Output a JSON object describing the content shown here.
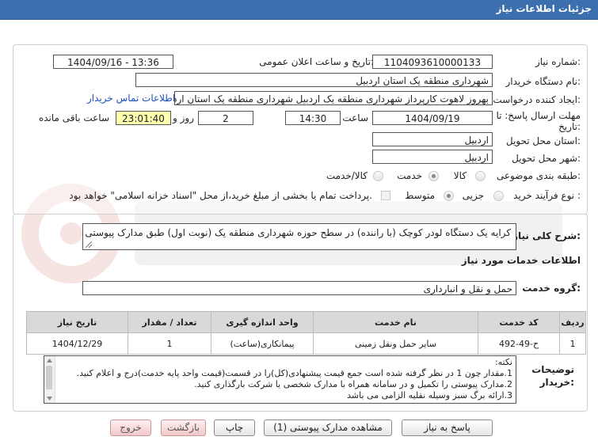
{
  "header": {
    "title": "جزئیات اطلاعات نیاز"
  },
  "fields": {
    "need_number_label": "شماره نیاز:",
    "need_number": "1104093610000133",
    "announce_label": "تاریخ و ساعت اعلان عمومی:",
    "announce_value": "1404/09/16 - 13:36",
    "buyer_label": "نام دستگاه خریدار:",
    "buyer_value": "شهرداری منطقه یک استان اردبیل",
    "creator_label": "ایجاد کننده درخواست:",
    "creator_value": "بهروز لاهوت کارپرداز شهرداری منطقه یک اردبیل شهرداری منطقه یک استان اردبیل",
    "contact_link": "اطلاعات تماس خریدار",
    "deadline_label_1": "مهلت ارسال پاسخ: تا",
    "deadline_label_2": "تاریخ:",
    "deadline_date": "1404/09/19",
    "time_label": "ساعت",
    "deadline_time": "14:30",
    "days_value": "2",
    "days_label": "روز و",
    "remaining_time": "23:01:40",
    "remaining_label": "ساعت باقی مانده",
    "province_label": "استان محل تحویل:",
    "province_value": "اردبیل",
    "city_label": "شهر محل تحویل:",
    "city_value": "اردبیل",
    "category_label": "طبقه بندی موضوعی:",
    "category_options": [
      "کالا",
      "خدمت",
      "کالا/خدمت"
    ],
    "process_label": "نوع فرآیند خرید :",
    "process_options": [
      "جزیی",
      "متوسط"
    ],
    "payment_note": "پرداخت تمام یا بخشی از مبلغ خرید،از محل \"اسناد خزانه اسلامی\" خواهد بود."
  },
  "summary": {
    "label": "شرح کلی نیاز:",
    "value": "کرایه یک دستگاه لودر کوچک (با راننده) در سطح حوزه شهرداری منطقه یک (نوبت اول) طبق مدارک پیوستی"
  },
  "services": {
    "section_title": "اطلاعات خدمات مورد نیاز",
    "group_label": "گروه خدمت:",
    "group_value": "حمل و نقل و انبارداری",
    "columns": [
      "ردیف",
      "کد خدمت",
      "نام خدمت",
      "واحد اندازه گیری",
      "تعداد / مقدار",
      "تاریخ نیاز"
    ],
    "rows": [
      {
        "idx": "1",
        "code": "ح-49-492",
        "name": "سایر حمل ونقل زمینی",
        "unit": "پیمانکاری(ساعت)",
        "qty": "1",
        "date": "1404/12/29"
      }
    ]
  },
  "notes": {
    "label_1": "توضیحات",
    "label_2": "خریدار:",
    "lines": [
      "نکته:",
      "1.مقدار چون 1 در نظر گرفته شده است جمع قیمت پیشنهادی(کل)را در قسمت(قیمت واحد پایه خدمت)درج و اعلام کنید.",
      "2.مدارک پیوستی را تکمیل و در سامانه همراه با مدارک شخصی یا شرکت بارگذاری کنید.",
      "3.ارائه برگ سبز وسیله نقلیه الزامی می باشد"
    ]
  },
  "buttons": {
    "reply": "پاسخ به نیاز",
    "view_docs": "مشاهده مدارک پیوستی (1)",
    "print": "چاپ",
    "back": "بازگشت",
    "exit": "خروج"
  }
}
